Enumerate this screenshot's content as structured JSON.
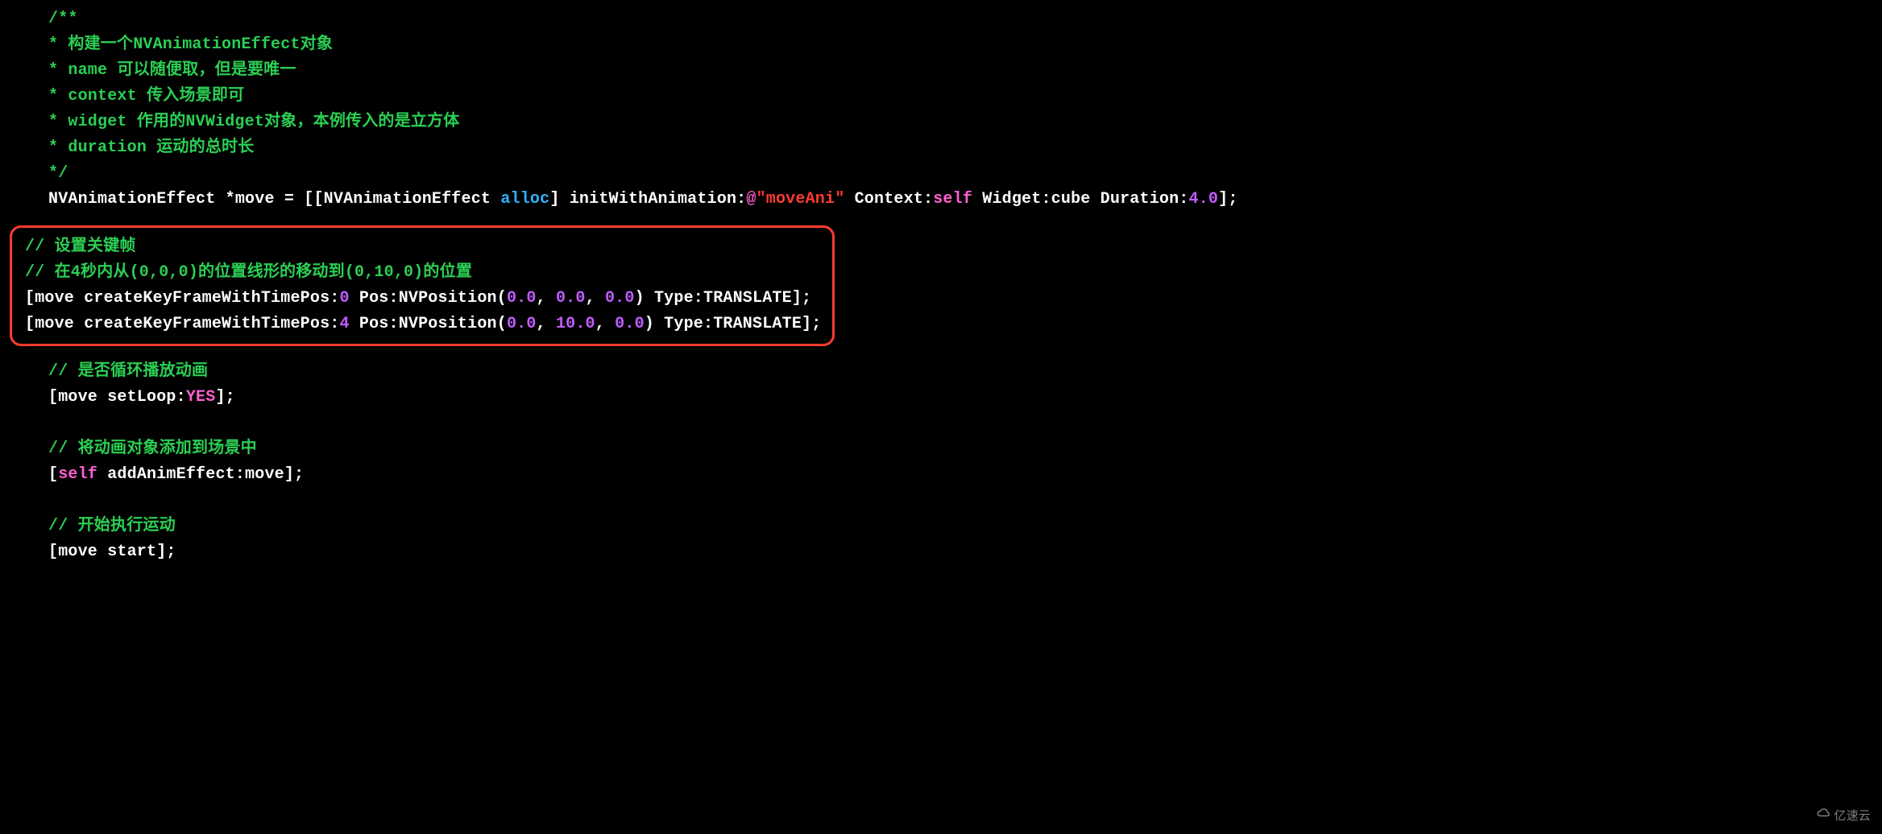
{
  "doc": {
    "c1": "/**",
    "c2": " * 构建一个NVAnimationEffect对象",
    "c3": " * name 可以随便取，但是要唯一",
    "c4": " * context 传入场景即可",
    "c5": " * widget 作用的NVWidget对象，本例传入的是立方体",
    "c6": " * duration 运动的总时长",
    "c7": " */"
  },
  "decl": {
    "type1": "NVAnimationEffect",
    "star": " *",
    "var": "move",
    "eq_open": " = [[",
    "type2": "NVAnimationEffect",
    "alloc": "alloc",
    "close_init": "] ",
    "init": "initWithAnimation:",
    "at": "@",
    "str": "\"moveAni\"",
    "ctx_lbl": " Context:",
    "selfkw": "self",
    "wid_lbl": " Widget:",
    "cube": "cube",
    "dur_lbl": " Duration:",
    "dur_val": "4.0",
    "end": "];"
  },
  "hl": {
    "c1": "//  设置关键帧",
    "c2": "//  在4秒内从(0,0,0)的位置线形的移动到(0,10,0)的位置",
    "l1": {
      "open": "[move ",
      "msg1": "createKeyFrameWithTimePos:",
      "n1": "0",
      "pos_lbl": " Pos:",
      "nvfn": "NVPosition(",
      "a": "0.0",
      "a2": "0.0",
      "a3": "0.0",
      "comma": ", ",
      "close_paren": ")",
      "type_lbl": " Type:",
      "trans": "TRANSLATE",
      "end": "];"
    },
    "l2": {
      "open": "[move ",
      "msg1": "createKeyFrameWithTimePos:",
      "n1": "4",
      "pos_lbl": " Pos:",
      "nvfn": "NVPosition(",
      "a": "0.0",
      "a2": "10.0",
      "a3": "0.0",
      "comma": ", ",
      "close_paren": ")",
      "type_lbl": " Type:",
      "trans": "TRANSLATE",
      "end": "];"
    }
  },
  "loop": {
    "c": "//  是否循环播放动画",
    "open": "[move ",
    "msg": "setLoop:",
    "yes": "YES",
    "end": "];"
  },
  "add": {
    "c": "//  将动画对象添加到场景中",
    "open": "[",
    "selfkw": "self",
    "sp": " ",
    "msg": "addAnimEffect:",
    "arg": "move",
    "end": "];"
  },
  "start": {
    "c": "//  开始执行运动",
    "open": "[move ",
    "msg": "start",
    "end": "];"
  },
  "watermark": "亿速云"
}
